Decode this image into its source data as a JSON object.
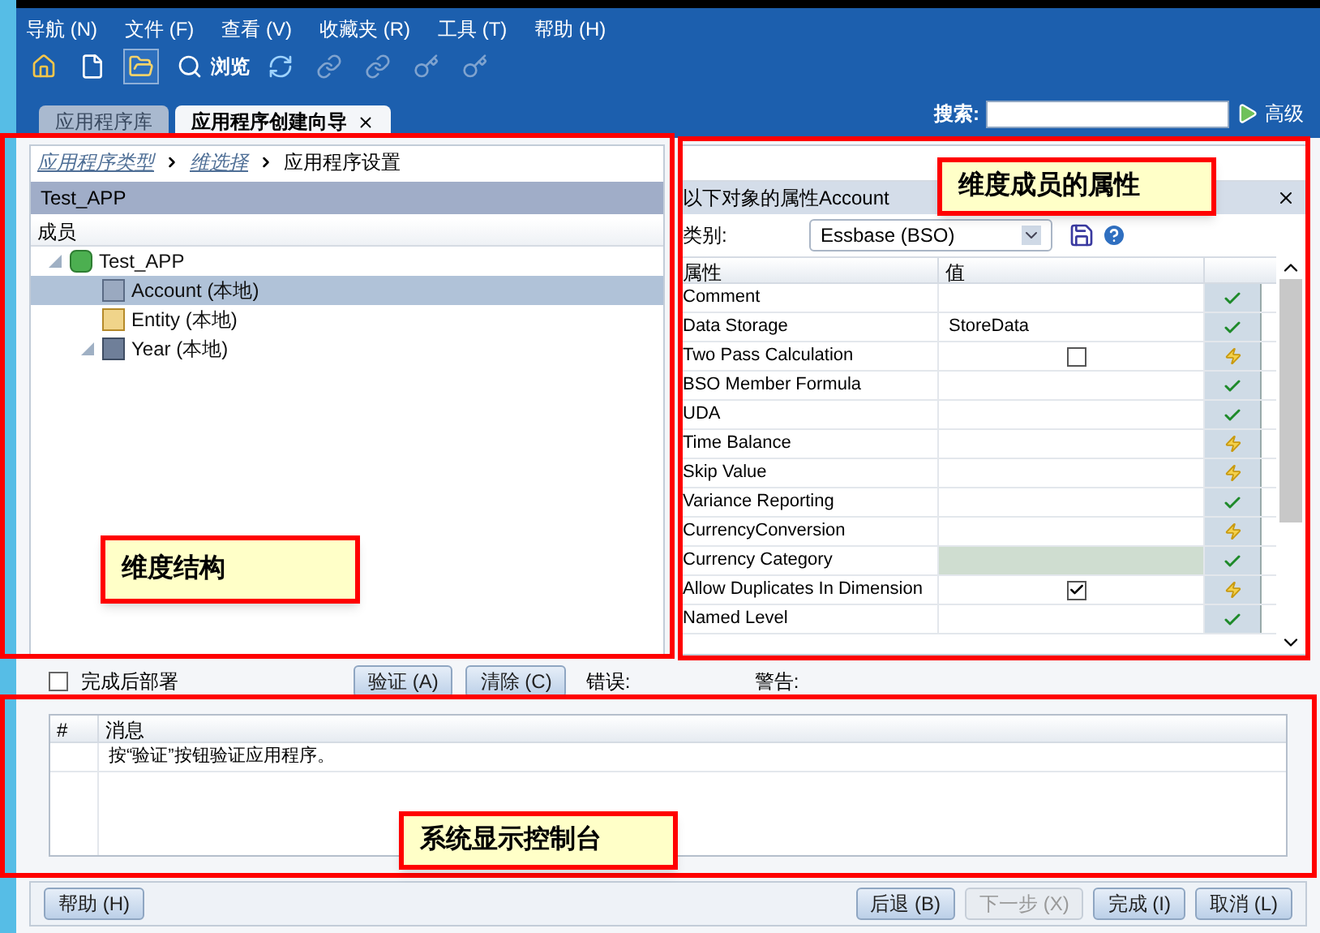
{
  "menu": [
    {
      "label": "导航 (N)"
    },
    {
      "label": "文件 (F)"
    },
    {
      "label": "查看 (V)"
    },
    {
      "label": "收藏夹 (R)"
    },
    {
      "label": "工具 (T)"
    },
    {
      "label": "帮助 (H)"
    }
  ],
  "toolbar": {
    "browse_label": "浏览",
    "buttons": [
      {
        "kind": "home",
        "selected": false,
        "disabled": false
      },
      {
        "kind": "new",
        "selected": false,
        "disabled": false
      },
      {
        "kind": "open",
        "selected": true,
        "disabled": false
      },
      {
        "kind": "browse",
        "selected": false,
        "disabled": false
      },
      {
        "kind": "refresh",
        "selected": false,
        "disabled": false
      },
      {
        "kind": "link",
        "selected": false,
        "disabled": true
      },
      {
        "kind": "link",
        "selected": false,
        "disabled": true
      },
      {
        "kind": "key",
        "selected": false,
        "disabled": true
      },
      {
        "kind": "key",
        "selected": false,
        "disabled": true
      }
    ]
  },
  "tabs": [
    {
      "label": "应用程序库",
      "selected": false
    },
    {
      "label": "应用程序创建向导",
      "selected": true
    }
  ],
  "search": {
    "label": "搜索:",
    "advanced": "高级"
  },
  "breadcrumb": [
    {
      "label": "应用程序类型",
      "current": false
    },
    {
      "label": "维选择",
      "current": false
    },
    {
      "label": "应用程序设置",
      "current": true
    }
  ],
  "tree_panel": {
    "title": "Test_APP",
    "column": "成员",
    "tree": [
      {
        "label": "Test_APP",
        "kind": "app",
        "expanded": true,
        "selected": false,
        "children": [
          {
            "label": "Account (本地)",
            "kind": "account",
            "selected": true
          },
          {
            "label": "Entity (本地)",
            "kind": "entity",
            "selected": false
          },
          {
            "label": "Year (本地)",
            "kind": "time",
            "expanded": true,
            "selected": false
          }
        ]
      }
    ]
  },
  "property_panel": {
    "title": "以下对象的属性Account",
    "category_label": "类别:",
    "category_value": "Essbase (BSO)",
    "columns": [
      "属性",
      "值"
    ],
    "rows": [
      {
        "name": "Comment",
        "kind": "text",
        "inherited": false,
        "highlighted": false
      },
      {
        "name": "Data Storage",
        "kind": "text",
        "value": "StoreData",
        "inherited": false,
        "highlighted": false
      },
      {
        "name": "Two Pass Calculation",
        "kind": "checkbox",
        "checked": false,
        "inherited": true,
        "highlighted": false
      },
      {
        "name": "BSO Member Formula",
        "kind": "text",
        "inherited": false,
        "highlighted": false
      },
      {
        "name": "UDA",
        "kind": "text",
        "inherited": false,
        "highlighted": false
      },
      {
        "name": "Time Balance",
        "kind": "text",
        "inherited": true,
        "highlighted": false
      },
      {
        "name": "Skip Value",
        "kind": "text",
        "inherited": true,
        "highlighted": false
      },
      {
        "name": "Variance Reporting",
        "kind": "text",
        "inherited": false,
        "highlighted": false
      },
      {
        "name": "CurrencyConversion",
        "kind": "text",
        "inherited": true,
        "highlighted": false
      },
      {
        "name": "Currency Category",
        "kind": "text",
        "inherited": false,
        "highlighted": true
      },
      {
        "name": "Allow Duplicates In Dimension",
        "kind": "checkbox",
        "checked": true,
        "inherited": true,
        "highlighted": false
      },
      {
        "name": "Named Level",
        "kind": "text",
        "inherited": false,
        "highlighted": false
      }
    ]
  },
  "validation": {
    "deploy": {
      "label": "完成后部署",
      "checked": false
    },
    "buttons": [
      {
        "label": "验证 (A)"
      },
      {
        "label": "清除 (C)"
      }
    ],
    "errors_label": "错误:",
    "warnings_label": "警告:"
  },
  "console": {
    "columns": [
      "#",
      "消息"
    ],
    "rows": [
      {
        "message": "按“验证”按钮验证应用程序。"
      }
    ]
  },
  "footer": {
    "help": "帮助 (H)",
    "buttons": [
      {
        "label": "后退 (B)",
        "disabled": false
      },
      {
        "label": "下一步 (X)",
        "disabled": true
      },
      {
        "label": "完成 (I)",
        "disabled": false
      },
      {
        "label": "取消 (L)",
        "disabled": false
      }
    ]
  },
  "callouts": [
    {
      "text": "维度成员的属性"
    },
    {
      "text": "维度结构"
    },
    {
      "text": "系统显示控制台"
    }
  ]
}
